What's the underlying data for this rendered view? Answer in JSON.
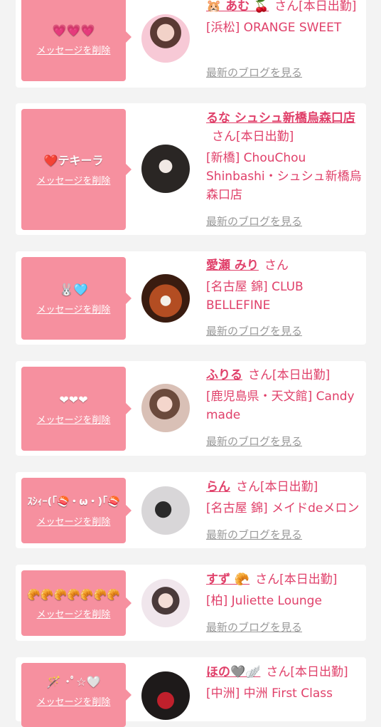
{
  "delete_label": "メッセージを削除",
  "blog_label": "最新のブログを見る",
  "colors": {
    "bubble": "#f6909f",
    "accent": "#e0406a",
    "link_gray": "#999999"
  },
  "cards": [
    {
      "message": "💗💗💗",
      "name": "🐹 あむ 🍒",
      "suffix": "さん[本日出勤]",
      "shop": "[浜松] ORANGE SWEET"
    },
    {
      "message": "❤️テキーラ",
      "name": "るな シュシュ新橋烏森口店",
      "suffix": "さん[本日出勤]",
      "shop": "[新橋] ChouChou Shinbashi・シュシュ新橋烏森口店"
    },
    {
      "message": "🐰🩵",
      "name": "愛瀬 みり",
      "suffix": "さん",
      "shop": "[名古屋 錦] CLUB BELLEFINE"
    },
    {
      "message": "❤❤❤",
      "name": "ふりる",
      "suffix": "さん[本日出勤]",
      "shop": "[鹿児島県・天文館] Candy made"
    },
    {
      "message": "ｽｼｨｰ(｢🍣・ω・)｢🍣",
      "name": "らん",
      "suffix": "さん[本日出勤]",
      "shop": "[名古屋 錦] メイドdeメロン"
    },
    {
      "message": "🥐🥐🥐🥐🥐🥐🥐",
      "name": "すず 🥐",
      "suffix": "さん[本日出勤]",
      "shop": "[柏] Juliette Lounge"
    },
    {
      "message": "🪄 ･ﾟ☆🤍",
      "name": "ほの🩶🪽",
      "suffix": "さん[本日出勤]",
      "shop": "[中洲] 中洲 First Class"
    }
  ]
}
